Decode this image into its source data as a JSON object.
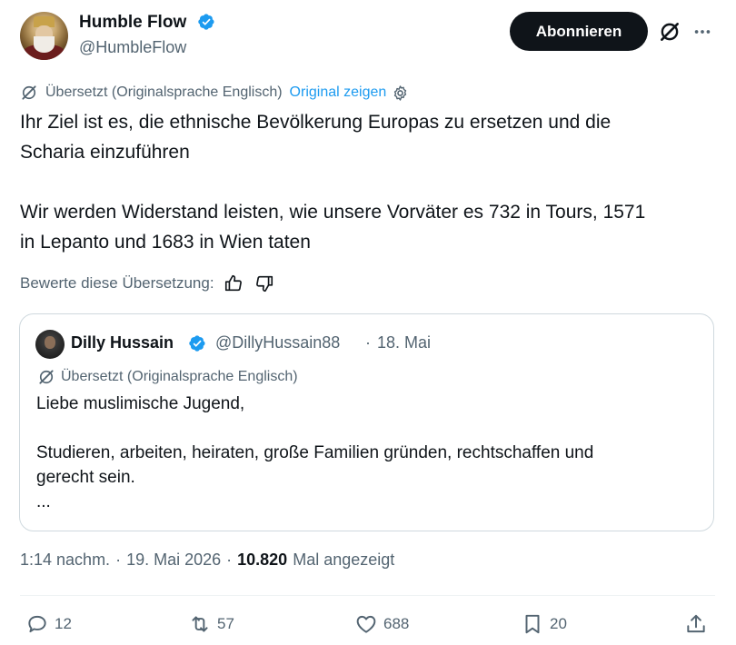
{
  "author": {
    "name": "Humble Flow",
    "handle": "@HumbleFlow",
    "verified_color": "#1d9bf0"
  },
  "header": {
    "follow_label": "Abonnieren",
    "grok_icon": "grok-icon",
    "more_icon": "more-icon"
  },
  "translation": {
    "note": "Übersetzt (Originalsprache Englisch)",
    "show_original": "Original zeigen"
  },
  "tweet": {
    "text": "Ihr Ziel ist es, die ethnische Bevölkerung Europas zu ersetzen und die\nScharia einzuführen\n\nWir werden Widerstand leisten, wie unsere Vorväter es 732 in Tours, 1571\nin Lepanto und 1683 in Wien taten"
  },
  "rating": {
    "label": "Bewerte diese Übersetzung:"
  },
  "quote": {
    "name": "Dilly Hussain",
    "handle": "@DillyHussain88",
    "separator": "·",
    "date": "18. Mai",
    "translation_note": "Übersetzt (Originalsprache Englisch)",
    "text": "Liebe muslimische Jugend,\n\nStudieren, arbeiten, heiraten, große Familien gründen, rechtschaffen und\ngerecht sein.\n..."
  },
  "meta": {
    "time": "1:14 nachm.",
    "separator": "·",
    "date": "19. Mai 2026",
    "views": "10.820",
    "views_label": "Mal angezeigt"
  },
  "actions": {
    "replies": "12",
    "reposts": "57",
    "likes": "688",
    "bookmarks": "20"
  },
  "colors": {
    "text": "#0f1419",
    "secondary": "#536471",
    "accent": "#1d9bf0",
    "border": "#cfd9de"
  }
}
